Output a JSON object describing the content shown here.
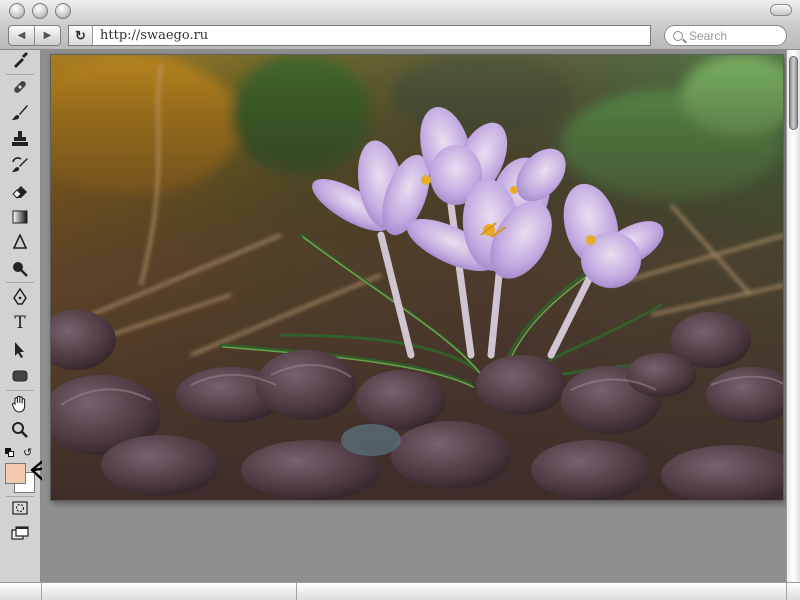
{
  "window": {
    "url": "http://swaego.ru",
    "search_placeholder": "Search"
  },
  "toolbar_buttons": {
    "back": "◀",
    "forward": "▶",
    "reload": "↻"
  },
  "tools": [
    "eyedropper-tool",
    "healing-brush-tool",
    "brush-tool",
    "clone-stamp-tool",
    "history-brush-tool",
    "eraser-tool",
    "gradient-tool",
    "blur-tool",
    "dodge-tool",
    "pen-tool",
    "type-tool",
    "path-selection-tool",
    "shape-tool",
    "hand-tool",
    "zoom-tool"
  ],
  "type_tool_glyph": "T",
  "colors": {
    "foreground": "#f6c8b0",
    "background": "#ffffff",
    "accent": "#000000"
  }
}
